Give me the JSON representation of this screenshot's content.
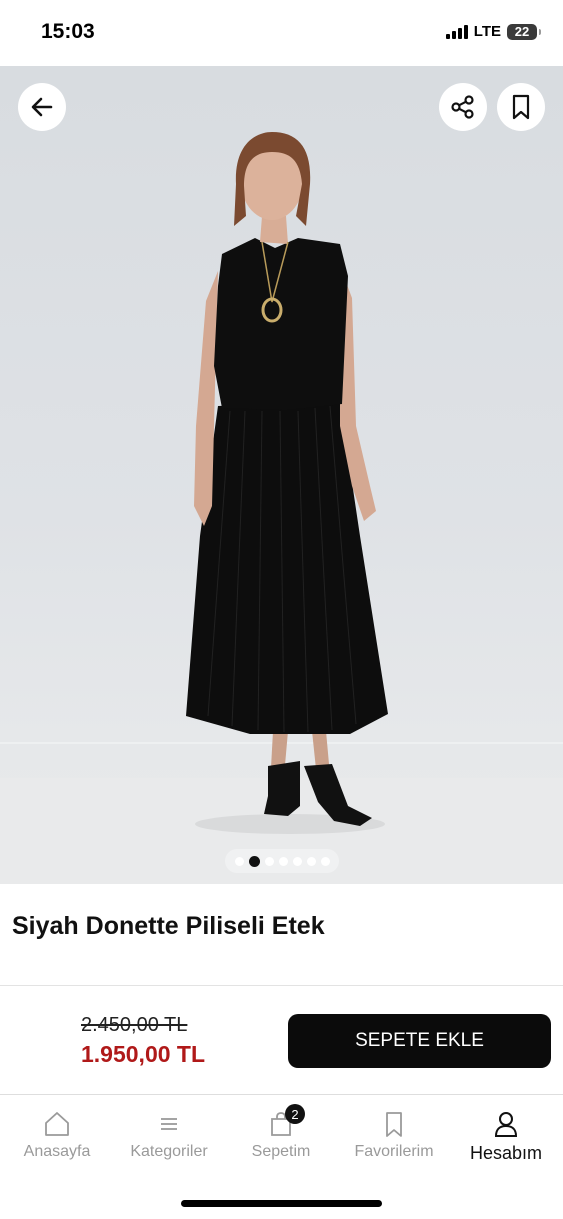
{
  "status": {
    "time": "15:03",
    "network": "LTE",
    "battery": "22"
  },
  "product": {
    "title": "Siyah Donette Piliseli Etek",
    "old_price": "2.450,00 TL",
    "price": "1.950,00 TL",
    "add_to_cart_label": "SEPETE EKLE",
    "image_count": 7,
    "active_image_index": 1
  },
  "tabs": [
    {
      "label": "Anasayfa",
      "icon": "home-icon",
      "active": false
    },
    {
      "label": "Kategoriler",
      "icon": "menu-icon",
      "active": false
    },
    {
      "label": "Sepetim",
      "icon": "bag-icon",
      "badge": "2",
      "active": false
    },
    {
      "label": "Favorilerim",
      "icon": "bookmark-icon",
      "active": false
    },
    {
      "label": "Hesabım",
      "icon": "user-icon",
      "active": true
    }
  ],
  "colors": {
    "accent": "#0b0b0b",
    "price": "#b01919",
    "tab_inactive": "#9a9a9a"
  }
}
